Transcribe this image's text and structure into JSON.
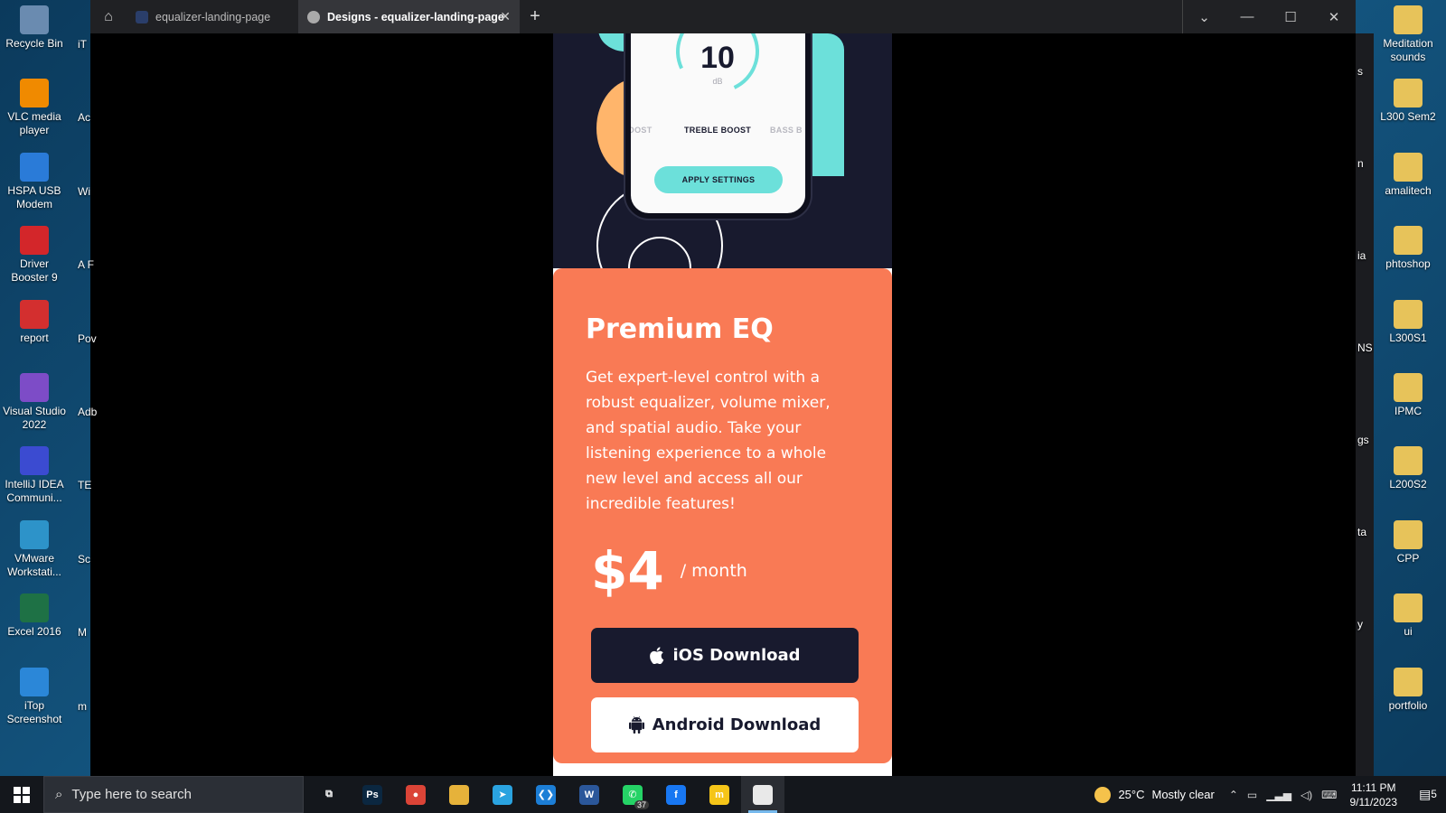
{
  "desktop": {
    "left_icons": [
      {
        "label": "Recycle Bin",
        "icon": "recycle-bin-icon",
        "color": "#6a8bb0"
      },
      {
        "label": "VLC media player",
        "icon": "vlc-icon",
        "color": "#f08a00"
      },
      {
        "label": "HSPA USB Modem",
        "icon": "globe-modem-icon",
        "color": "#2a7bd8"
      },
      {
        "label": "Driver Booster 9",
        "icon": "driver-booster-icon",
        "color": "#d3262a"
      },
      {
        "label": "report",
        "icon": "pdf-icon",
        "color": "#d32f2f"
      },
      {
        "label": "Visual Studio 2022",
        "icon": "visual-studio-icon",
        "color": "#7d4cc7"
      },
      {
        "label": "IntelliJ IDEA Communi...",
        "icon": "intellij-icon",
        "color": "#3b4bd1"
      },
      {
        "label": "VMware Workstati...",
        "icon": "vmware-icon",
        "color": "#2d93c9"
      },
      {
        "label": "Excel 2016",
        "icon": "excel-icon",
        "color": "#1e7145"
      },
      {
        "label": "iTop Screenshot",
        "icon": "itop-screenshot-icon",
        "color": "#2b87d8"
      }
    ],
    "partial_left_labels": [
      "iT",
      "Ac",
      "Wi",
      "A\nF",
      "Pov",
      "Adb",
      "TE",
      "Sc",
      "M",
      "m"
    ],
    "right_icons": [
      {
        "label": "Meditation sounds",
        "icon": "folder-icon"
      },
      {
        "label": "L300 Sem2",
        "icon": "folder-icon"
      },
      {
        "label": "amalitech",
        "icon": "folder-icon"
      },
      {
        "label": "phtoshop",
        "icon": "folder-icon"
      },
      {
        "label": "L300S1",
        "icon": "folder-icon"
      },
      {
        "label": "IPMC",
        "icon": "folder-icon"
      },
      {
        "label": "L200S2",
        "icon": "folder-icon"
      },
      {
        "label": "CPP",
        "icon": "folder-icon"
      },
      {
        "label": "ui",
        "icon": "folder-icon"
      },
      {
        "label": "portfolio",
        "icon": "folder-icon"
      }
    ],
    "partial_right_labels": [
      "s",
      "n",
      "ia",
      "NS",
      "gs",
      "ta",
      "y"
    ]
  },
  "browser": {
    "tabs": [
      {
        "label": "equalizer-landing-page",
        "active": false,
        "icon": "vscode-favicon-icon"
      },
      {
        "label": "Designs - equalizer-landing-page",
        "active": true,
        "icon": "play-favicon-icon"
      }
    ],
    "close_tab": "✕",
    "new_tab": "+",
    "home": "⌂",
    "window_controls": {
      "dropdown": "⌄",
      "minimize": "—",
      "maximize": "☐",
      "close": "✕"
    }
  },
  "phone": {
    "dial_value": "10",
    "dial_unit": "dB",
    "presets": [
      "BOOST",
      "TREBLE BOOST",
      "BASS B"
    ],
    "apply_label": "APPLY SETTINGS"
  },
  "card": {
    "title": "Premium EQ",
    "description": "Get expert-level control with a robust equalizer, volume mixer, and spatial audio. Take your listening experience to a whole new level and access all our incredible features!",
    "price": "$4",
    "period": "/ month",
    "ios_label": "iOS Download",
    "android_label": "Android Download"
  },
  "taskbar": {
    "search_placeholder": "Type here to search",
    "apps": [
      {
        "name": "task-view",
        "icon": "task-view-icon",
        "color": "transparent",
        "glyph": "⧉"
      },
      {
        "name": "photoshop",
        "icon": "photoshop-icon",
        "color": "#0b2740",
        "glyph": "Ps"
      },
      {
        "name": "chrome",
        "icon": "chrome-icon",
        "color": "#db4437",
        "glyph": "●"
      },
      {
        "name": "file-explorer",
        "icon": "folder-icon",
        "color": "#e6b23a",
        "glyph": ""
      },
      {
        "name": "telegram",
        "icon": "telegram-icon",
        "color": "#2aa3e0",
        "glyph": "➤"
      },
      {
        "name": "vscode",
        "icon": "vscode-icon",
        "color": "#1c7ed6",
        "glyph": "❮❯"
      },
      {
        "name": "word",
        "icon": "word-icon",
        "color": "#2b579a",
        "glyph": "W"
      },
      {
        "name": "whatsapp",
        "icon": "whatsapp-icon",
        "color": "#25d366",
        "glyph": "✆",
        "badge": "37"
      },
      {
        "name": "facebook",
        "icon": "facebook-icon",
        "color": "#1877f2",
        "glyph": "f"
      },
      {
        "name": "mtn",
        "icon": "mtn-icon",
        "color": "#f5c518",
        "glyph": "m"
      },
      {
        "name": "notepad",
        "icon": "document-icon",
        "color": "#e9e9e9",
        "glyph": ""
      }
    ],
    "weather": {
      "temp": "25°C",
      "condition": "Mostly clear"
    },
    "time": "11:11 PM",
    "date": "9/11/2023",
    "notifications": "5"
  }
}
